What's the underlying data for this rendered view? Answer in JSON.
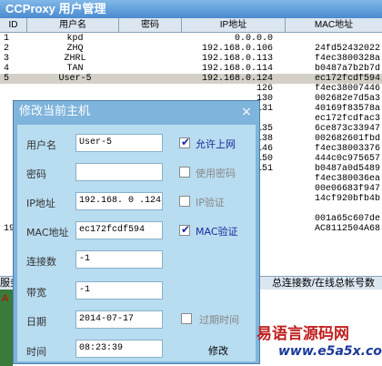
{
  "window": {
    "title": "CCProxy 用户管理"
  },
  "grid": {
    "columns": [
      "ID",
      "用户名",
      "密码",
      "IP地址",
      "MAC地址"
    ],
    "rows": [
      {
        "id": "1",
        "user": "kpd",
        "ip": "0.0.0.0",
        "mac": ""
      },
      {
        "id": "2",
        "user": "ZHQ",
        "ip": "192.168.0.106",
        "mac": "24fd52432022"
      },
      {
        "id": "3",
        "user": "ZHRL",
        "ip": "192.168.0.113",
        "mac": "f4ec3800328a"
      },
      {
        "id": "4",
        "user": "TAN",
        "ip": "192.168.0.114",
        "mac": "b0487a7b2b7d"
      },
      {
        "id": "5",
        "user": "User-5",
        "ip": "192.168.0.124",
        "mac": "ec172fcdf594"
      },
      {
        "id": "",
        "user": "",
        "ip": "126",
        "mac": "f4ec38007446"
      },
      {
        "id": "",
        "user": "",
        "ip": "130",
        "mac": "002682e7d5a3"
      },
      {
        "id": "",
        "user": "",
        "ip": "131",
        "mac": "40169f83578a"
      },
      {
        "id": "",
        "user": "",
        "ip": "",
        "mac": "ec172fcdfac3"
      },
      {
        "id": "",
        "user": "",
        "ip": "135",
        "mac": "6ce873c33947"
      },
      {
        "id": "",
        "user": "",
        "ip": "138",
        "mac": "002682601fbd"
      },
      {
        "id": "",
        "user": "",
        "ip": "146",
        "mac": "f4ec38003376"
      },
      {
        "id": "",
        "user": "",
        "ip": "150",
        "mac": "444c0c975657"
      },
      {
        "id": "",
        "user": "",
        "ip": "151",
        "mac": "b0487a0d5489"
      },
      {
        "id": "",
        "user": "",
        "ip": "",
        "mac": "f4ec380036ea"
      },
      {
        "id": "",
        "user": "",
        "ip": "",
        "mac": "00e06683f947"
      },
      {
        "id": "",
        "user": "",
        "ip": "",
        "mac": "14cf920bfb4b"
      },
      {
        "id": "",
        "user": "",
        "ip": "",
        "mac": ""
      },
      {
        "id": "",
        "user": "",
        "ip": "",
        "mac": "001a65c607de"
      },
      {
        "id": "19",
        "user": "",
        "ip": "",
        "mac": "AC8112504A68"
      }
    ]
  },
  "status": {
    "left": "服务",
    "right": "总连接数/在线总帐号数"
  },
  "bottom": {
    "label": "A"
  },
  "dialog": {
    "title": "修改当前主机",
    "close": "×",
    "fields": {
      "username": {
        "label": "用户名",
        "value": "User-5"
      },
      "password": {
        "label": "密码",
        "value": ""
      },
      "ip": {
        "label": "IP地址",
        "value": "192.168. 0 .124"
      },
      "mac": {
        "label": "MAC地址",
        "value": "ec172fcdf594"
      },
      "connections": {
        "label": "连接数",
        "value": "-1"
      },
      "bandwidth": {
        "label": "带宽",
        "value": "-1"
      },
      "date": {
        "label": "日期",
        "value": "2014-07-17"
      },
      "time": {
        "label": "时间",
        "value": "08:23:39"
      }
    },
    "checks": {
      "allow": {
        "label": "允许上网",
        "checked": true
      },
      "use_password": {
        "label": "使用密码",
        "checked": false
      },
      "ip_verify": {
        "label": "IP验证",
        "checked": false
      },
      "mac_verify": {
        "label": "MAC验证",
        "checked": true
      },
      "expire": {
        "label": "过期时间",
        "checked": false
      }
    },
    "modify_label": "修改"
  },
  "watermark": {
    "cn": "易语言源码网",
    "url": "www.e5a5x.com"
  }
}
